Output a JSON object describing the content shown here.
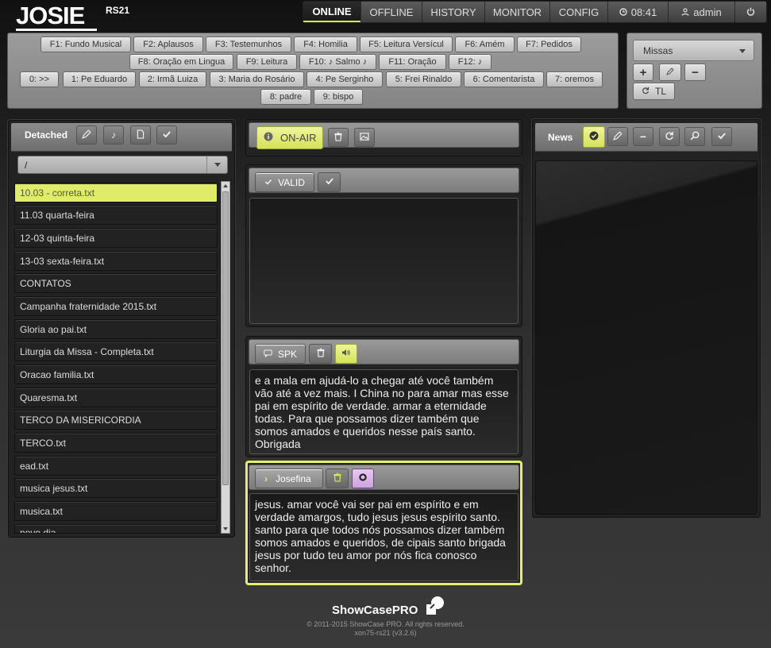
{
  "app": {
    "logo": "JOSIE",
    "subtitle": "RS21"
  },
  "nav": {
    "items": [
      "ONLINE",
      "OFFLINE",
      "HISTORY",
      "MONITOR",
      "CONFIG"
    ],
    "clock": "08:41",
    "user": "admin"
  },
  "hotkeys": {
    "row1": [
      "F1: Fundo Musical",
      "F2: Aplausos",
      "F3: Testemunhos",
      "F4: Homilia",
      "F5: Leitura Versícul",
      "F6: Amém",
      "F7: Pedidos"
    ],
    "row2": [
      "F8: Oração em Lingua",
      "F9: Leitura",
      "F10: ♪ Salmo ♪",
      "F11: Oração",
      "F12: ♪"
    ],
    "row3": [
      "0: >>",
      "1: Pe Eduardo",
      "2: Irmã Luiza",
      "3: Maria do Rosário",
      "4: Pe Serginho",
      "5: Frei Rinaldo",
      "6: Comentarista",
      "7: oremos"
    ],
    "row4": [
      "8: padre",
      "9: bispo"
    ]
  },
  "profile": {
    "select": "Missas",
    "tl_label": "TL"
  },
  "files": {
    "title": "Detached",
    "path": "/",
    "items": [
      "10.03 - correta.txt",
      "11.03 quarta-feira",
      "12-03 quinta-feira",
      "13-03 sexta-feira.txt",
      "CONTATOS",
      "Campanha fraternidade 2015.txt",
      "Gloria ao pai.txt",
      "Liturgia da Missa - Completa.txt",
      "Oracao familia.txt",
      "Quaresma.txt",
      "TERCO DA MISERICORDIA",
      "TERCO.txt",
      "ead.txt",
      "musica jesus.txt",
      "musica.txt",
      "novo dia"
    ]
  },
  "onair": {
    "label": "ON-AIR"
  },
  "valid": {
    "label": "VALID",
    "text": ""
  },
  "spk": {
    "label": "SPK",
    "text": "e a mala em ajudá-lo a chegar até você também vão até a vez mais. I China no para amar mas esse pai em espírito de verdade. armar a eternidade todas. Para que possamos dizer também que somos amados e queridos nesse país santo. Obrigada"
  },
  "josefina": {
    "label": "Josefina",
    "text": "jesus. amar você vai ser pai em espírito e em verdade amargos, tudo jesus jesus espírito santo. santo para que todos nós possamos dizer também somos amados e queridos, de cipais santo brigada jesus por tudo teu amor por nós fica conosco senhor."
  },
  "news": {
    "title": "News"
  },
  "footer": {
    "brand": "ShowCasePRO",
    "copyright": "© 2011-2015 ShowCase PRO. All rights reserved.",
    "version": "xon75-rs21 (v3.2.6)"
  },
  "colors": {
    "accent": "#d8e94e",
    "selected": "#dfec6a",
    "josefina_border": "#e2f06a",
    "record": "#d9b4e8"
  }
}
